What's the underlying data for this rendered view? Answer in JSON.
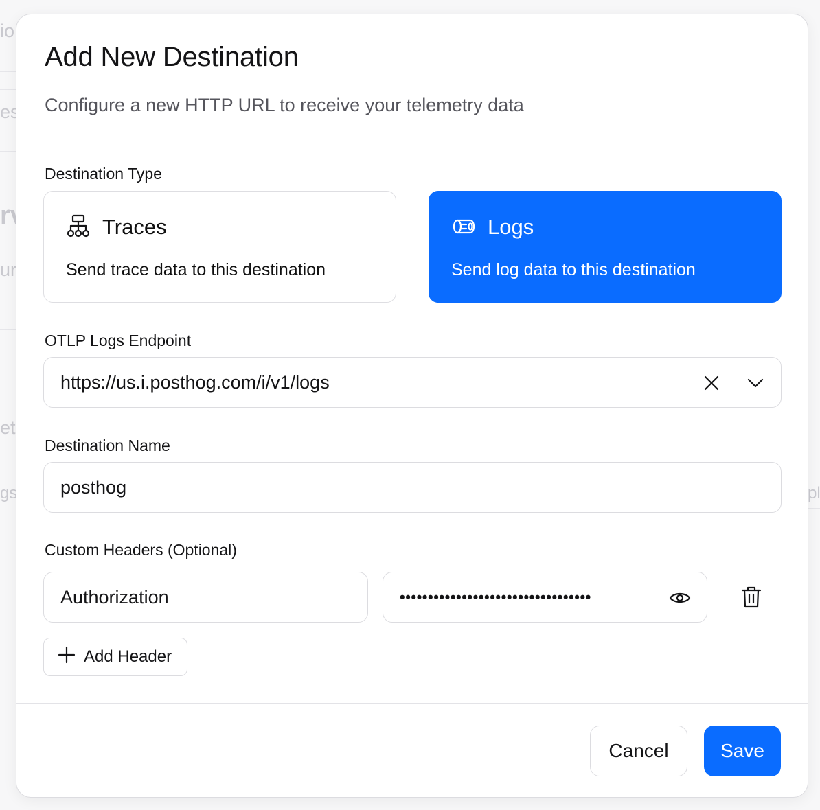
{
  "dialog": {
    "title": "Add New Destination",
    "subtitle": "Configure a new HTTP URL to receive your telemetry data"
  },
  "destination_type": {
    "label": "Destination Type",
    "selected": "Logs",
    "options": [
      {
        "title": "Traces",
        "description": "Send trace data to this destination",
        "icon": "sitemap-icon"
      },
      {
        "title": "Logs",
        "description": "Send log data to this destination",
        "icon": "log-scroll-icon"
      }
    ]
  },
  "endpoint": {
    "label": "OTLP Logs Endpoint",
    "value": "https://us.i.posthog.com/i/v1/logs"
  },
  "name": {
    "label": "Destination Name",
    "value": "posthog"
  },
  "headers": {
    "label": "Custom Headers (Optional)",
    "rows": [
      {
        "key": "Authorization",
        "value_masked": "••••••••••••••••••••••••••••••••••"
      }
    ],
    "add_label": "Add Header"
  },
  "footer": {
    "cancel_label": "Cancel",
    "save_label": "Save"
  },
  "colors": {
    "accent": "#0a6cff",
    "border": "#dcdce0",
    "text": "#141416",
    "muted": "#55555c"
  }
}
